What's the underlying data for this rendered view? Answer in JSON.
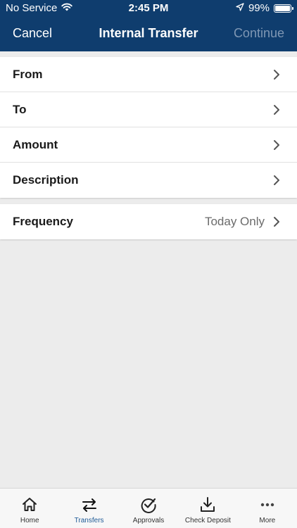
{
  "status_bar": {
    "carrier": "No Service",
    "time": "2:45 PM",
    "battery": "99%",
    "battery_level": 0.99
  },
  "nav": {
    "left": "Cancel",
    "title": "Internal Transfer",
    "right": "Continue"
  },
  "form": {
    "rows": [
      {
        "label": "From"
      },
      {
        "label": "To"
      },
      {
        "label": "Amount"
      },
      {
        "label": "Description"
      }
    ],
    "frequency": {
      "label": "Frequency",
      "value": "Today Only"
    }
  },
  "tabbar": {
    "tabs": [
      {
        "label": "Home",
        "icon": "home-icon"
      },
      {
        "label": "Transfers",
        "icon": "transfer-arrows-icon",
        "active": true
      },
      {
        "label": "Approvals",
        "icon": "check-circle-icon"
      },
      {
        "label": "Check Deposit",
        "icon": "download-tray-icon"
      },
      {
        "label": "More",
        "icon": "more-dots-icon"
      }
    ]
  },
  "colors": {
    "nav_bg": "#0f3d6e",
    "active_tab": "#1e5a96",
    "disabled_action": "#7f97b4",
    "background": "#ececec"
  }
}
